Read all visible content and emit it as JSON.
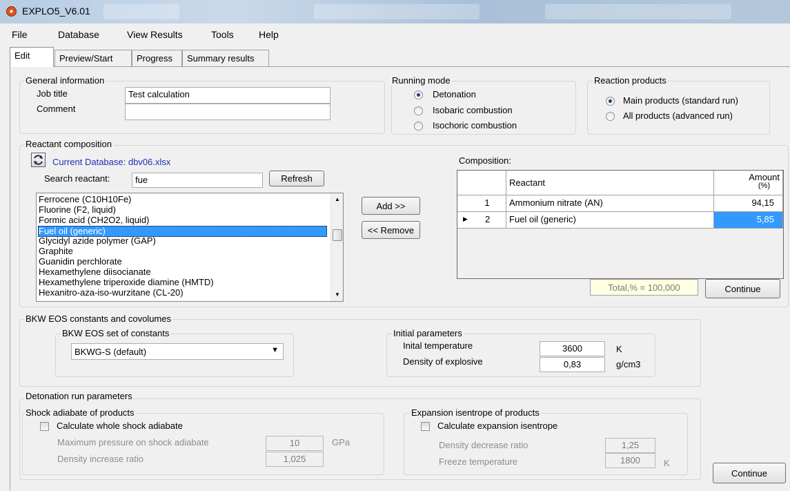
{
  "window": {
    "title": "EXPLO5_V6.01"
  },
  "menu": [
    "File",
    "Database",
    "View Results",
    "Tools",
    "Help"
  ],
  "tabs": [
    "Edit",
    "Preview/Start",
    "Progress",
    "Summary results"
  ],
  "general": {
    "title": "General information",
    "job_title_label": "Job title",
    "job_title_value": "Test calculation",
    "comment_label": "Comment",
    "comment_value": ""
  },
  "running_mode": {
    "title": "Running mode",
    "options": [
      "Detonation",
      "Isobaric combustion",
      "Isochoric combustion"
    ],
    "selected": "Detonation"
  },
  "reaction_products": {
    "title": "Reaction products",
    "options": [
      "Main products (standard run)",
      "All products (advanced run)"
    ],
    "selected": "Main products (standard run)"
  },
  "reactant": {
    "title": "Reactant composition",
    "current_db": "Current Database: dbv06.xlsx",
    "search_label": "Search reactant:",
    "search_value": "fue",
    "refresh": "Refresh",
    "add": "Add >>",
    "remove": "<< Remove",
    "list": [
      "Ferrocene (C10H10Fe)",
      "Fluorine (F2, liquid)",
      "Formic acid (CH2O2, liquid)",
      "Fuel oil (generic)",
      "Glycidyl azide polymer (GAP)",
      "Graphite",
      "Guanidin perchlorate",
      "Hexamethylene diisocianate",
      "Hexamethylene triperoxide diamine (HMTD)",
      "Hexanitro-aza-iso-wurzitane (CL-20)"
    ],
    "selected": "Fuel oil (generic)"
  },
  "composition": {
    "title": "Composition:",
    "col_reactant": "Reactant",
    "col_amount": "Amount",
    "col_amount_unit": "(%)",
    "rows": [
      {
        "n": "1",
        "name": "Ammonium nitrate (AN)",
        "amount": "94,15"
      },
      {
        "n": "2",
        "name": "Fuel oil (generic)",
        "amount": "5,85"
      }
    ],
    "total": "Total,% = 100,000",
    "continue": "Continue"
  },
  "bkw": {
    "title": "BKW EOS constants and covolumes",
    "set_title": "BKW EOS set of constants",
    "set_value": "BKWG-S  (default)"
  },
  "initial": {
    "title": "Initial parameters",
    "temp_label": "Inital temperature",
    "temp_value": "3600",
    "temp_unit": "K",
    "density_label": "Density of explosive",
    "density_value": "0,83",
    "density_unit": "g/cm3"
  },
  "detonation": {
    "title": "Detonation run parameters",
    "shock": {
      "title": "Shock adiabate of products",
      "check_label": "Calculate whole shock adiabate",
      "max_p_label": "Maximum pressure on shock adiabate",
      "max_p_value": "10",
      "max_p_unit": "GPa",
      "dens_label": "Density increase ratio",
      "dens_value": "1,025"
    },
    "expansion": {
      "title": "Expansion isentrope of products",
      "check_label": "Calculate expansion isentrope",
      "ratio_label": "Density decrease ratio",
      "ratio_value": "1,25",
      "freeze_label": "Freeze temperature",
      "freeze_value": "1800",
      "freeze_unit": "K"
    },
    "continue": "Continue"
  }
}
